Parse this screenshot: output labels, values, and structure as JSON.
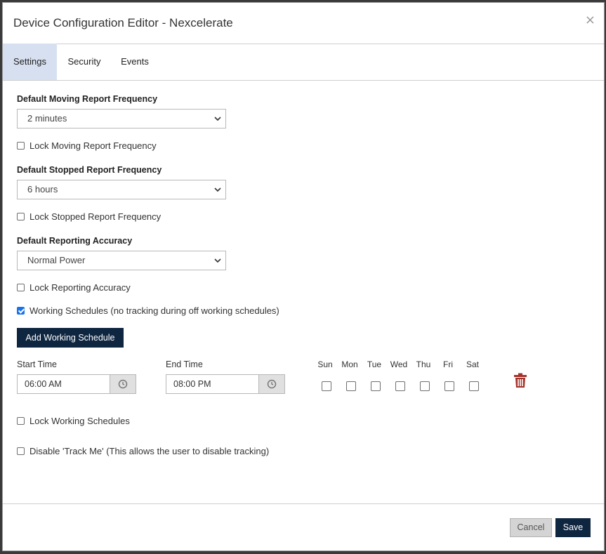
{
  "modal": {
    "title": "Device Configuration Editor - Nexcelerate",
    "close_glyph": "×"
  },
  "tabs": [
    {
      "label": "Settings",
      "active": true
    },
    {
      "label": "Security",
      "active": false
    },
    {
      "label": "Events",
      "active": false
    }
  ],
  "settings": {
    "moving_frequency": {
      "label": "Default Moving Report Frequency",
      "value": "2 minutes",
      "lock_label": "Lock Moving Report Frequency",
      "lock_checked": false
    },
    "stopped_frequency": {
      "label": "Default Stopped Report Frequency",
      "value": "6 hours",
      "lock_label": "Lock Stopped Report Frequency",
      "lock_checked": false
    },
    "accuracy": {
      "label": "Default Reporting Accuracy",
      "value": "Normal Power",
      "lock_label": "Lock Reporting Accuracy",
      "lock_checked": false
    },
    "working_schedules": {
      "label": "Working Schedules (no tracking during off working schedules)",
      "checked": true,
      "add_button": "Add Working Schedule",
      "start_label": "Start Time",
      "end_label": "End Time",
      "schedule": {
        "start_time": "06:00 AM",
        "end_time": "08:00 PM",
        "days": [
          {
            "label": "Sun",
            "checked": false
          },
          {
            "label": "Mon",
            "checked": false
          },
          {
            "label": "Tue",
            "checked": false
          },
          {
            "label": "Wed",
            "checked": false
          },
          {
            "label": "Thu",
            "checked": false
          },
          {
            "label": "Fri",
            "checked": false
          },
          {
            "label": "Sat",
            "checked": false
          }
        ]
      },
      "lock_label": "Lock Working Schedules",
      "lock_checked": false
    },
    "track_me": {
      "label": "Disable 'Track Me' (This allows the user to disable tracking)",
      "checked": false
    }
  },
  "footer": {
    "cancel_label": "Cancel",
    "save_label": "Save"
  },
  "colors": {
    "primary_dark": "#0f2641",
    "tab_active_bg": "#d7e0f0",
    "checkbox_checked": "#1a73e8",
    "trash_icon": "#a5322b"
  },
  "icons": {
    "close": "close-icon",
    "select_arrow": "chevron-down-icon",
    "clock": "clock-icon",
    "delete": "trash-icon"
  }
}
